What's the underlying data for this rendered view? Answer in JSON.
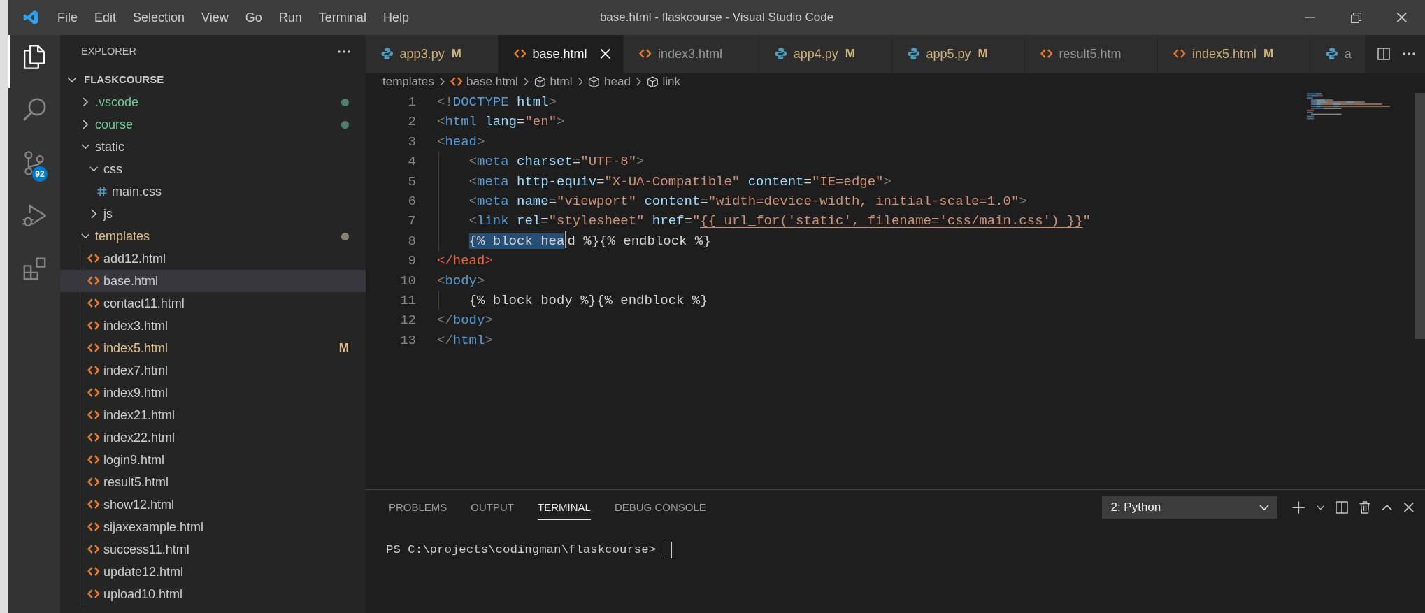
{
  "window": {
    "title": "base.html - flaskcourse - Visual Studio Code"
  },
  "menu": [
    "File",
    "Edit",
    "Selection",
    "View",
    "Go",
    "Run",
    "Terminal",
    "Help"
  ],
  "activity_bar": [
    {
      "kind": "explorer",
      "selected": true
    },
    {
      "kind": "search",
      "selected": false
    },
    {
      "kind": "source_control",
      "selected": false,
      "badge": "92"
    },
    {
      "kind": "run",
      "selected": false
    },
    {
      "kind": "extensions",
      "selected": false
    }
  ],
  "explorer": {
    "title": "EXPLORER",
    "root": {
      "label": "FLASKCOURSE",
      "expanded": true,
      "children": [
        {
          "label": ".vscode",
          "kind": "folder",
          "expanded": false,
          "untracked": true,
          "modified": false,
          "selected": false
        },
        {
          "label": "course",
          "kind": "folder",
          "expanded": false,
          "untracked": true,
          "modified": false,
          "selected": false
        },
        {
          "label": "static",
          "kind": "folder",
          "expanded": true,
          "untracked": false,
          "modified": false,
          "selected": false,
          "children": [
            {
              "label": "css",
              "kind": "folder",
              "expanded": true,
              "untracked": false,
              "modified": false,
              "selected": false,
              "children": [
                {
                  "label": "main.css",
                  "kind": "css",
                  "untracked": false,
                  "modified": false,
                  "selected": false
                }
              ]
            },
            {
              "label": "js",
              "kind": "folder",
              "expanded": false,
              "untracked": false,
              "modified": false,
              "selected": false
            }
          ]
        },
        {
          "label": "templates",
          "kind": "folder",
          "expanded": true,
          "untracked": false,
          "modified": true,
          "selected": false,
          "children": [
            {
              "label": "add12.html",
              "kind": "html",
              "untracked": false,
              "modified": false,
              "selected": false
            },
            {
              "label": "base.html",
              "kind": "html",
              "untracked": false,
              "modified": false,
              "selected": true
            },
            {
              "label": "contact11.html",
              "kind": "html",
              "untracked": false,
              "modified": false,
              "selected": false
            },
            {
              "label": "index3.html",
              "kind": "html",
              "untracked": false,
              "modified": false,
              "selected": false
            },
            {
              "label": "index5.html",
              "kind": "html",
              "untracked": false,
              "modified": true,
              "badge": "M",
              "selected": false
            },
            {
              "label": "index7.html",
              "kind": "html",
              "untracked": false,
              "modified": false,
              "selected": false
            },
            {
              "label": "index9.html",
              "kind": "html",
              "untracked": false,
              "modified": false,
              "selected": false
            },
            {
              "label": "index21.html",
              "kind": "html",
              "untracked": false,
              "modified": false,
              "selected": false
            },
            {
              "label": "index22.html",
              "kind": "html",
              "untracked": false,
              "modified": false,
              "selected": false
            },
            {
              "label": "login9.html",
              "kind": "html",
              "untracked": false,
              "modified": false,
              "selected": false
            },
            {
              "label": "result5.html",
              "kind": "html",
              "untracked": false,
              "modified": false,
              "selected": false
            },
            {
              "label": "show12.html",
              "kind": "html",
              "untracked": false,
              "modified": false,
              "selected": false
            },
            {
              "label": "sijaxexample.html",
              "kind": "html",
              "untracked": false,
              "modified": false,
              "selected": false
            },
            {
              "label": "success11.html",
              "kind": "html",
              "untracked": false,
              "modified": false,
              "selected": false
            },
            {
              "label": "update12.html",
              "kind": "html",
              "untracked": false,
              "modified": false,
              "selected": false
            },
            {
              "label": "upload10.html",
              "kind": "html",
              "untracked": false,
              "modified": false,
              "selected": false
            }
          ]
        }
      ]
    }
  },
  "tabs": [
    {
      "label": "app3.py",
      "kind": "python",
      "modified": true,
      "badge": "M",
      "selected": false
    },
    {
      "label": "base.html",
      "kind": "html",
      "modified": false,
      "selected": true
    },
    {
      "label": "index3.html",
      "kind": "html",
      "modified": false,
      "selected": false
    },
    {
      "label": "app4.py",
      "kind": "python",
      "modified": true,
      "badge": "M",
      "selected": false
    },
    {
      "label": "app5.py",
      "kind": "python",
      "modified": true,
      "badge": "M",
      "selected": false
    },
    {
      "label": "result5.htm",
      "kind": "html",
      "modified": false,
      "selected": false
    },
    {
      "label": "index5.html",
      "kind": "html",
      "modified": true,
      "badge": "M",
      "selected": false
    },
    {
      "label": "a",
      "kind": "python",
      "modified": false,
      "selected": false
    }
  ],
  "breadcrumb": [
    {
      "label": "templates",
      "kind": "folder"
    },
    {
      "label": "base.html",
      "kind": "html"
    },
    {
      "label": "html",
      "kind": "symbol"
    },
    {
      "label": "head",
      "kind": "symbol"
    },
    {
      "label": "link",
      "kind": "symbol"
    }
  ],
  "editor": {
    "lines": [
      {
        "number": "1",
        "indented": false,
        "tokens": [
          {
            "kind": "punct",
            "text": "<!"
          },
          {
            "kind": "tag",
            "text": "DOCTYPE"
          },
          {
            "kind": "attr",
            "text": " html"
          },
          {
            "kind": "punct",
            "text": ">"
          }
        ]
      },
      {
        "number": "2",
        "indented": false,
        "tokens": [
          {
            "kind": "punct",
            "text": "<"
          },
          {
            "kind": "tag",
            "text": "html"
          },
          {
            "kind": "attr",
            "text": " lang"
          },
          {
            "kind": "text",
            "text": "="
          },
          {
            "kind": "string",
            "text": "\"en\""
          },
          {
            "kind": "punct",
            "text": ">"
          }
        ]
      },
      {
        "number": "3",
        "indented": false,
        "tokens": [
          {
            "kind": "punct",
            "text": "<"
          },
          {
            "kind": "tag",
            "text": "head"
          },
          {
            "kind": "punct",
            "text": ">"
          }
        ]
      },
      {
        "number": "4",
        "indented": true,
        "tokens": [
          {
            "kind": "punct",
            "text": "<"
          },
          {
            "kind": "tag",
            "text": "meta"
          },
          {
            "kind": "attr",
            "text": " charset"
          },
          {
            "kind": "text",
            "text": "="
          },
          {
            "kind": "string",
            "text": "\"UTF-8\""
          },
          {
            "kind": "punct",
            "text": ">"
          }
        ]
      },
      {
        "number": "5",
        "indented": true,
        "tokens": [
          {
            "kind": "punct",
            "text": "<"
          },
          {
            "kind": "tag",
            "text": "meta"
          },
          {
            "kind": "attr",
            "text": " http-equiv"
          },
          {
            "kind": "text",
            "text": "="
          },
          {
            "kind": "string",
            "text": "\"X-UA-Compatible\""
          },
          {
            "kind": "attr",
            "text": " content"
          },
          {
            "kind": "text",
            "text": "="
          },
          {
            "kind": "string",
            "text": "\"IE=edge\""
          },
          {
            "kind": "punct",
            "text": ">"
          }
        ]
      },
      {
        "number": "6",
        "indented": true,
        "tokens": [
          {
            "kind": "punct",
            "text": "<"
          },
          {
            "kind": "tag",
            "text": "meta"
          },
          {
            "kind": "attr",
            "text": " name"
          },
          {
            "kind": "text",
            "text": "="
          },
          {
            "kind": "string",
            "text": "\"viewport\""
          },
          {
            "kind": "attr",
            "text": " content"
          },
          {
            "kind": "text",
            "text": "="
          },
          {
            "kind": "string",
            "text": "\"width=device-width, initial-scale=1.0\""
          },
          {
            "kind": "punct",
            "text": ">"
          }
        ]
      },
      {
        "number": "7",
        "indented": true,
        "tokens": [
          {
            "kind": "punct",
            "text": "<"
          },
          {
            "kind": "tag",
            "text": "link"
          },
          {
            "kind": "attr",
            "text": " rel"
          },
          {
            "kind": "text",
            "text": "="
          },
          {
            "kind": "string",
            "text": "\"stylesheet\""
          },
          {
            "kind": "attr",
            "text": " href"
          },
          {
            "kind": "text",
            "text": "="
          },
          {
            "kind": "string",
            "text": "\""
          },
          {
            "kind": "link",
            "text": "{{ url_for('static', filename='css/main.css') }}"
          },
          {
            "kind": "string",
            "text": "\""
          }
        ]
      },
      {
        "number": "8",
        "indented": true,
        "tokens": [
          {
            "kind": "selection",
            "text": "{% block hea"
          },
          {
            "kind": "text",
            "text": "d %}{% endblock %}"
          }
        ]
      },
      {
        "number": "9",
        "indented": false,
        "tokens": [
          {
            "kind": "invalid",
            "text": "</head>"
          }
        ]
      },
      {
        "number": "10",
        "indented": false,
        "tokens": [
          {
            "kind": "punct",
            "text": "<"
          },
          {
            "kind": "tag",
            "text": "body"
          },
          {
            "kind": "punct",
            "text": ">"
          }
        ]
      },
      {
        "number": "11",
        "indented": true,
        "tokens": [
          {
            "kind": "text",
            "text": "{% block body %}{% endblock %}"
          }
        ]
      },
      {
        "number": "12",
        "indented": false,
        "tokens": [
          {
            "kind": "punct",
            "text": "</"
          },
          {
            "kind": "tag",
            "text": "body"
          },
          {
            "kind": "punct",
            "text": ">"
          }
        ]
      },
      {
        "number": "13",
        "indented": false,
        "tokens": [
          {
            "kind": "punct",
            "text": "</"
          },
          {
            "kind": "tag",
            "text": "html"
          },
          {
            "kind": "punct",
            "text": ">"
          }
        ]
      }
    ]
  },
  "panel": {
    "tabs": [
      {
        "label": "PROBLEMS",
        "selected": false
      },
      {
        "label": "OUTPUT",
        "selected": false
      },
      {
        "label": "TERMINAL",
        "selected": true
      },
      {
        "label": "DEBUG CONSOLE",
        "selected": false
      }
    ],
    "terminal_select": {
      "value": "2: Python"
    },
    "terminal": {
      "prompt": "PS C:\\projects\\codingman\\flaskcourse>"
    }
  }
}
